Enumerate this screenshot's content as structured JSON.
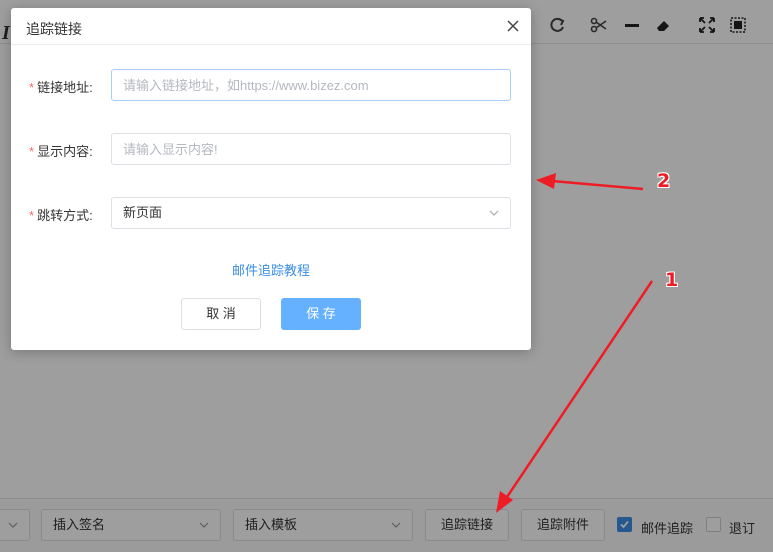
{
  "dialog": {
    "title": "追踪链接",
    "fields": {
      "url": {
        "label": "链接地址:",
        "placeholder": "请输入链接地址，如https://www.bizez.com",
        "value": ""
      },
      "display": {
        "label": "显示内容:",
        "placeholder": "请输入显示内容!",
        "value": ""
      },
      "jump": {
        "label": "跳转方式:",
        "value": "新页面"
      }
    },
    "tutorial_link": "邮件追踪教程",
    "cancel_label": "取 消",
    "save_label": "保 存"
  },
  "bottom_bar": {
    "signature_select": "插入签名",
    "template_select": "插入模板",
    "track_link_button": "追踪链接",
    "track_attachment_button": "追踪附件",
    "mail_tracking": {
      "label": "邮件追踪",
      "checked": true
    },
    "receipt": {
      "label": "退订",
      "checked": false
    }
  },
  "annotations": {
    "label1": "1",
    "label2": "2"
  },
  "colors": {
    "primary": "#3a8ee6",
    "save_button": "#66b1ff",
    "required": "#f56c6c",
    "arrow": "#ee1c24"
  }
}
